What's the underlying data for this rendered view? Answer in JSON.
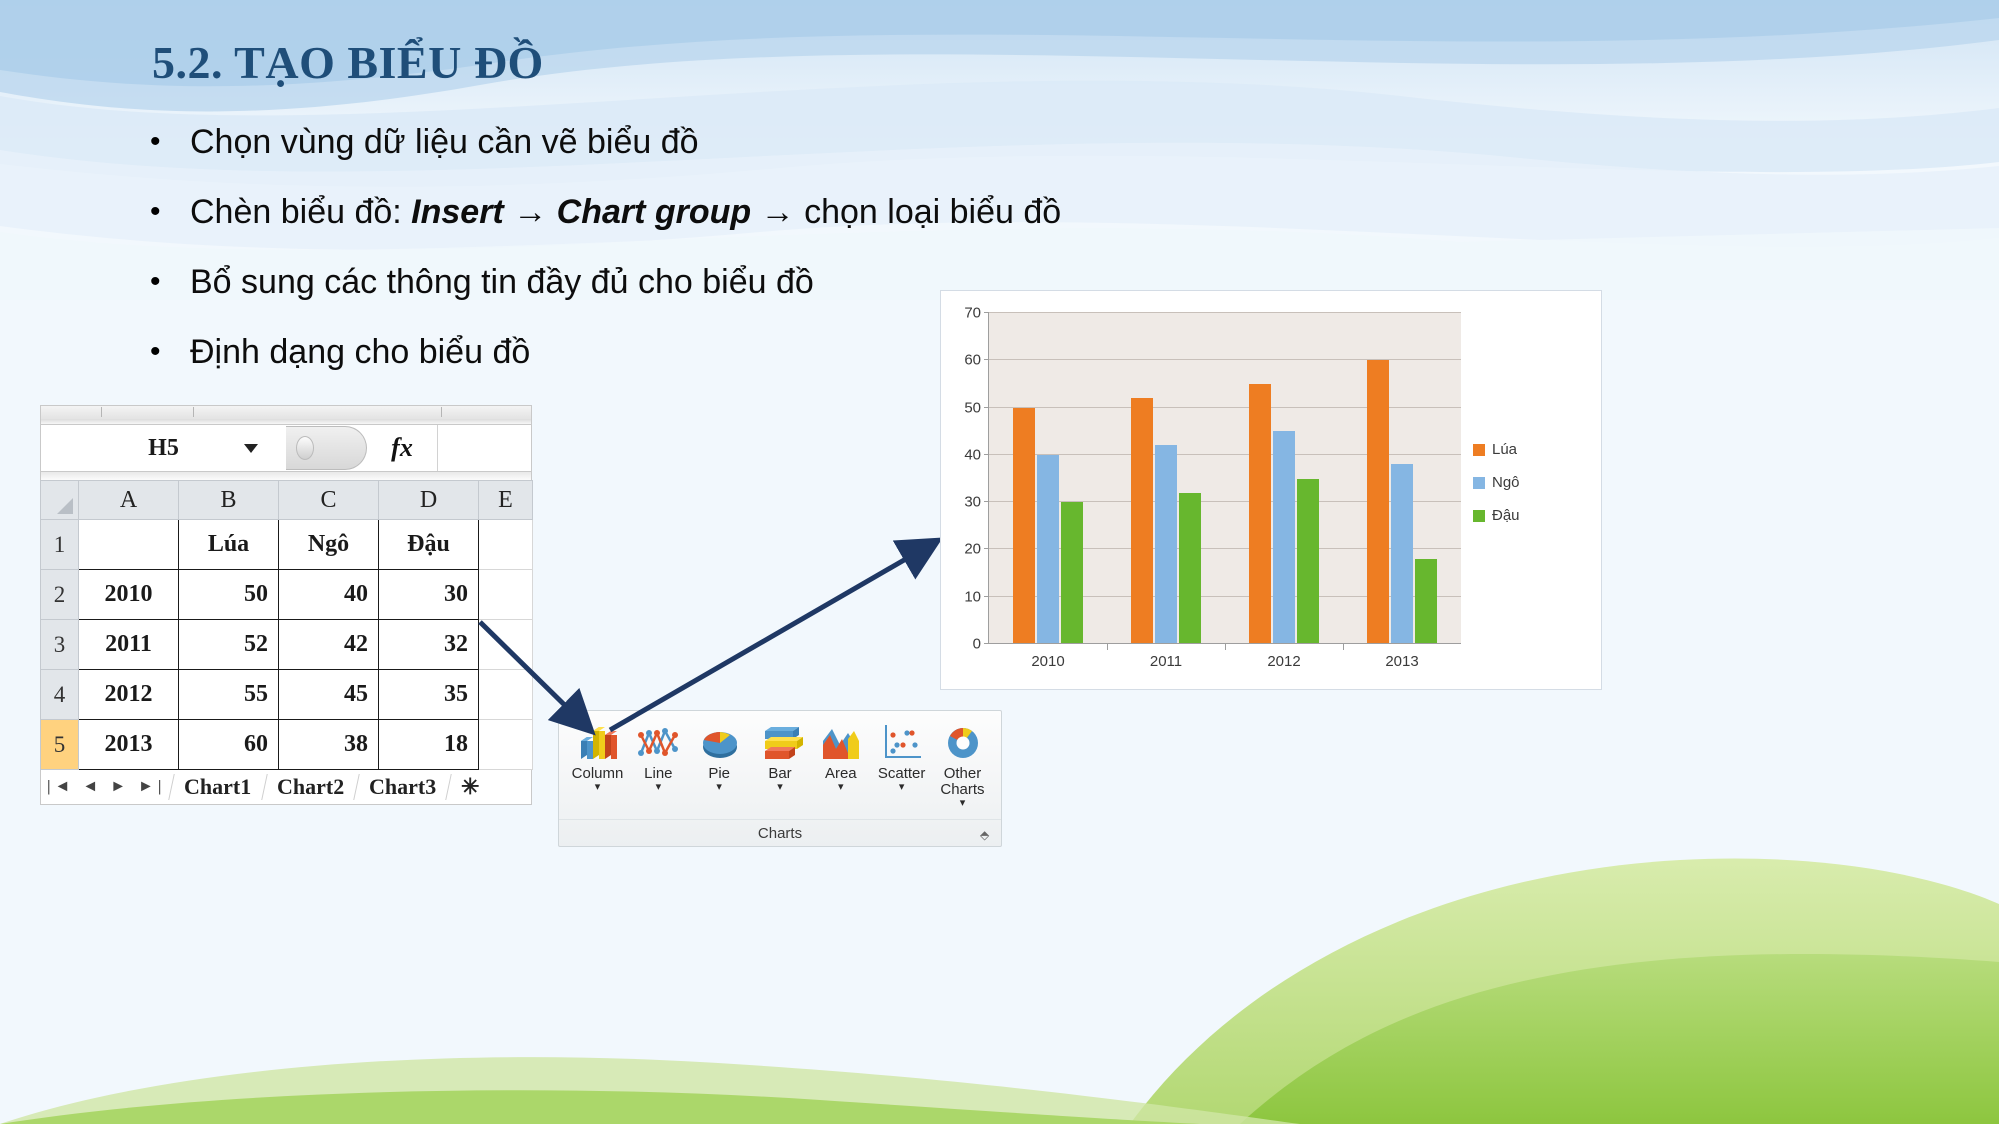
{
  "slide": {
    "title": "5.2. TẠO BIỂU ĐỒ",
    "bullet_marker": "•",
    "bullets": [
      {
        "pre": "Chọn vùng dữ liệu cần vẽ biểu đồ",
        "bold": "",
        "post": ""
      },
      {
        "pre": "Chèn biểu đồ: ",
        "bold": "Insert → Chart group",
        "post": " → chọn loại biểu đồ"
      },
      {
        "pre": "Bổ sung các thông tin đầy đủ cho biểu đồ",
        "bold": "",
        "post": ""
      },
      {
        "pre": "Định dạng cho biểu đồ",
        "bold": "",
        "post": ""
      }
    ]
  },
  "excel": {
    "name_box_value": "H5",
    "formula_icon": "fx",
    "formula_value": "",
    "column_headers": [
      "A",
      "B",
      "C",
      "D",
      "E"
    ],
    "rows": [
      {
        "num": "1",
        "cells": [
          "",
          "Lúa",
          "Ngô",
          "Đậu",
          ""
        ]
      },
      {
        "num": "2",
        "cells": [
          "2010",
          "50",
          "40",
          "30",
          ""
        ]
      },
      {
        "num": "3",
        "cells": [
          "2011",
          "52",
          "42",
          "32",
          ""
        ]
      },
      {
        "num": "4",
        "cells": [
          "2012",
          "55",
          "45",
          "35",
          ""
        ]
      },
      {
        "num": "5",
        "cells": [
          "2013",
          "60",
          "38",
          "18",
          ""
        ]
      }
    ],
    "selected_row": "5",
    "sheet_nav": "|◄ ◄ ► ►|",
    "sheet_tabs": [
      "Chart1",
      "Chart2",
      "Chart3",
      "✳"
    ]
  },
  "ribbon": {
    "group_label": "Charts",
    "dialog_launcher": "⬘",
    "items": [
      {
        "label": "Column",
        "caret": "▾",
        "icon": "column-chart-icon"
      },
      {
        "label": "Line",
        "caret": "▾",
        "icon": "line-chart-icon"
      },
      {
        "label": "Pie",
        "caret": "▾",
        "icon": "pie-chart-icon"
      },
      {
        "label": "Bar",
        "caret": "▾",
        "icon": "bar-chart-icon"
      },
      {
        "label": "Area",
        "caret": "▾",
        "icon": "area-chart-icon"
      },
      {
        "label": "Scatter",
        "caret": "▾",
        "icon": "scatter-chart-icon"
      },
      {
        "label": "Other Charts",
        "caret": "▾",
        "icon": "other-charts-icon"
      }
    ]
  },
  "chart_data": {
    "type": "bar",
    "title": "",
    "xlabel": "",
    "ylabel": "",
    "categories": [
      "2010",
      "2011",
      "2012",
      "2013"
    ],
    "series": [
      {
        "name": "Lúa",
        "color": "#ee7d22",
        "values": [
          50,
          52,
          55,
          60
        ]
      },
      {
        "name": "Ngô",
        "color": "#85b6e3",
        "values": [
          40,
          42,
          45,
          38
        ]
      },
      {
        "name": "Đậu",
        "color": "#67b72e",
        "values": [
          30,
          32,
          35,
          18
        ]
      }
    ],
    "ylim": [
      0,
      70
    ],
    "yticks": [
      0,
      10,
      20,
      30,
      40,
      50,
      60,
      70
    ],
    "grid": true,
    "legend_position": "right",
    "plot_background": "#efeae6"
  }
}
